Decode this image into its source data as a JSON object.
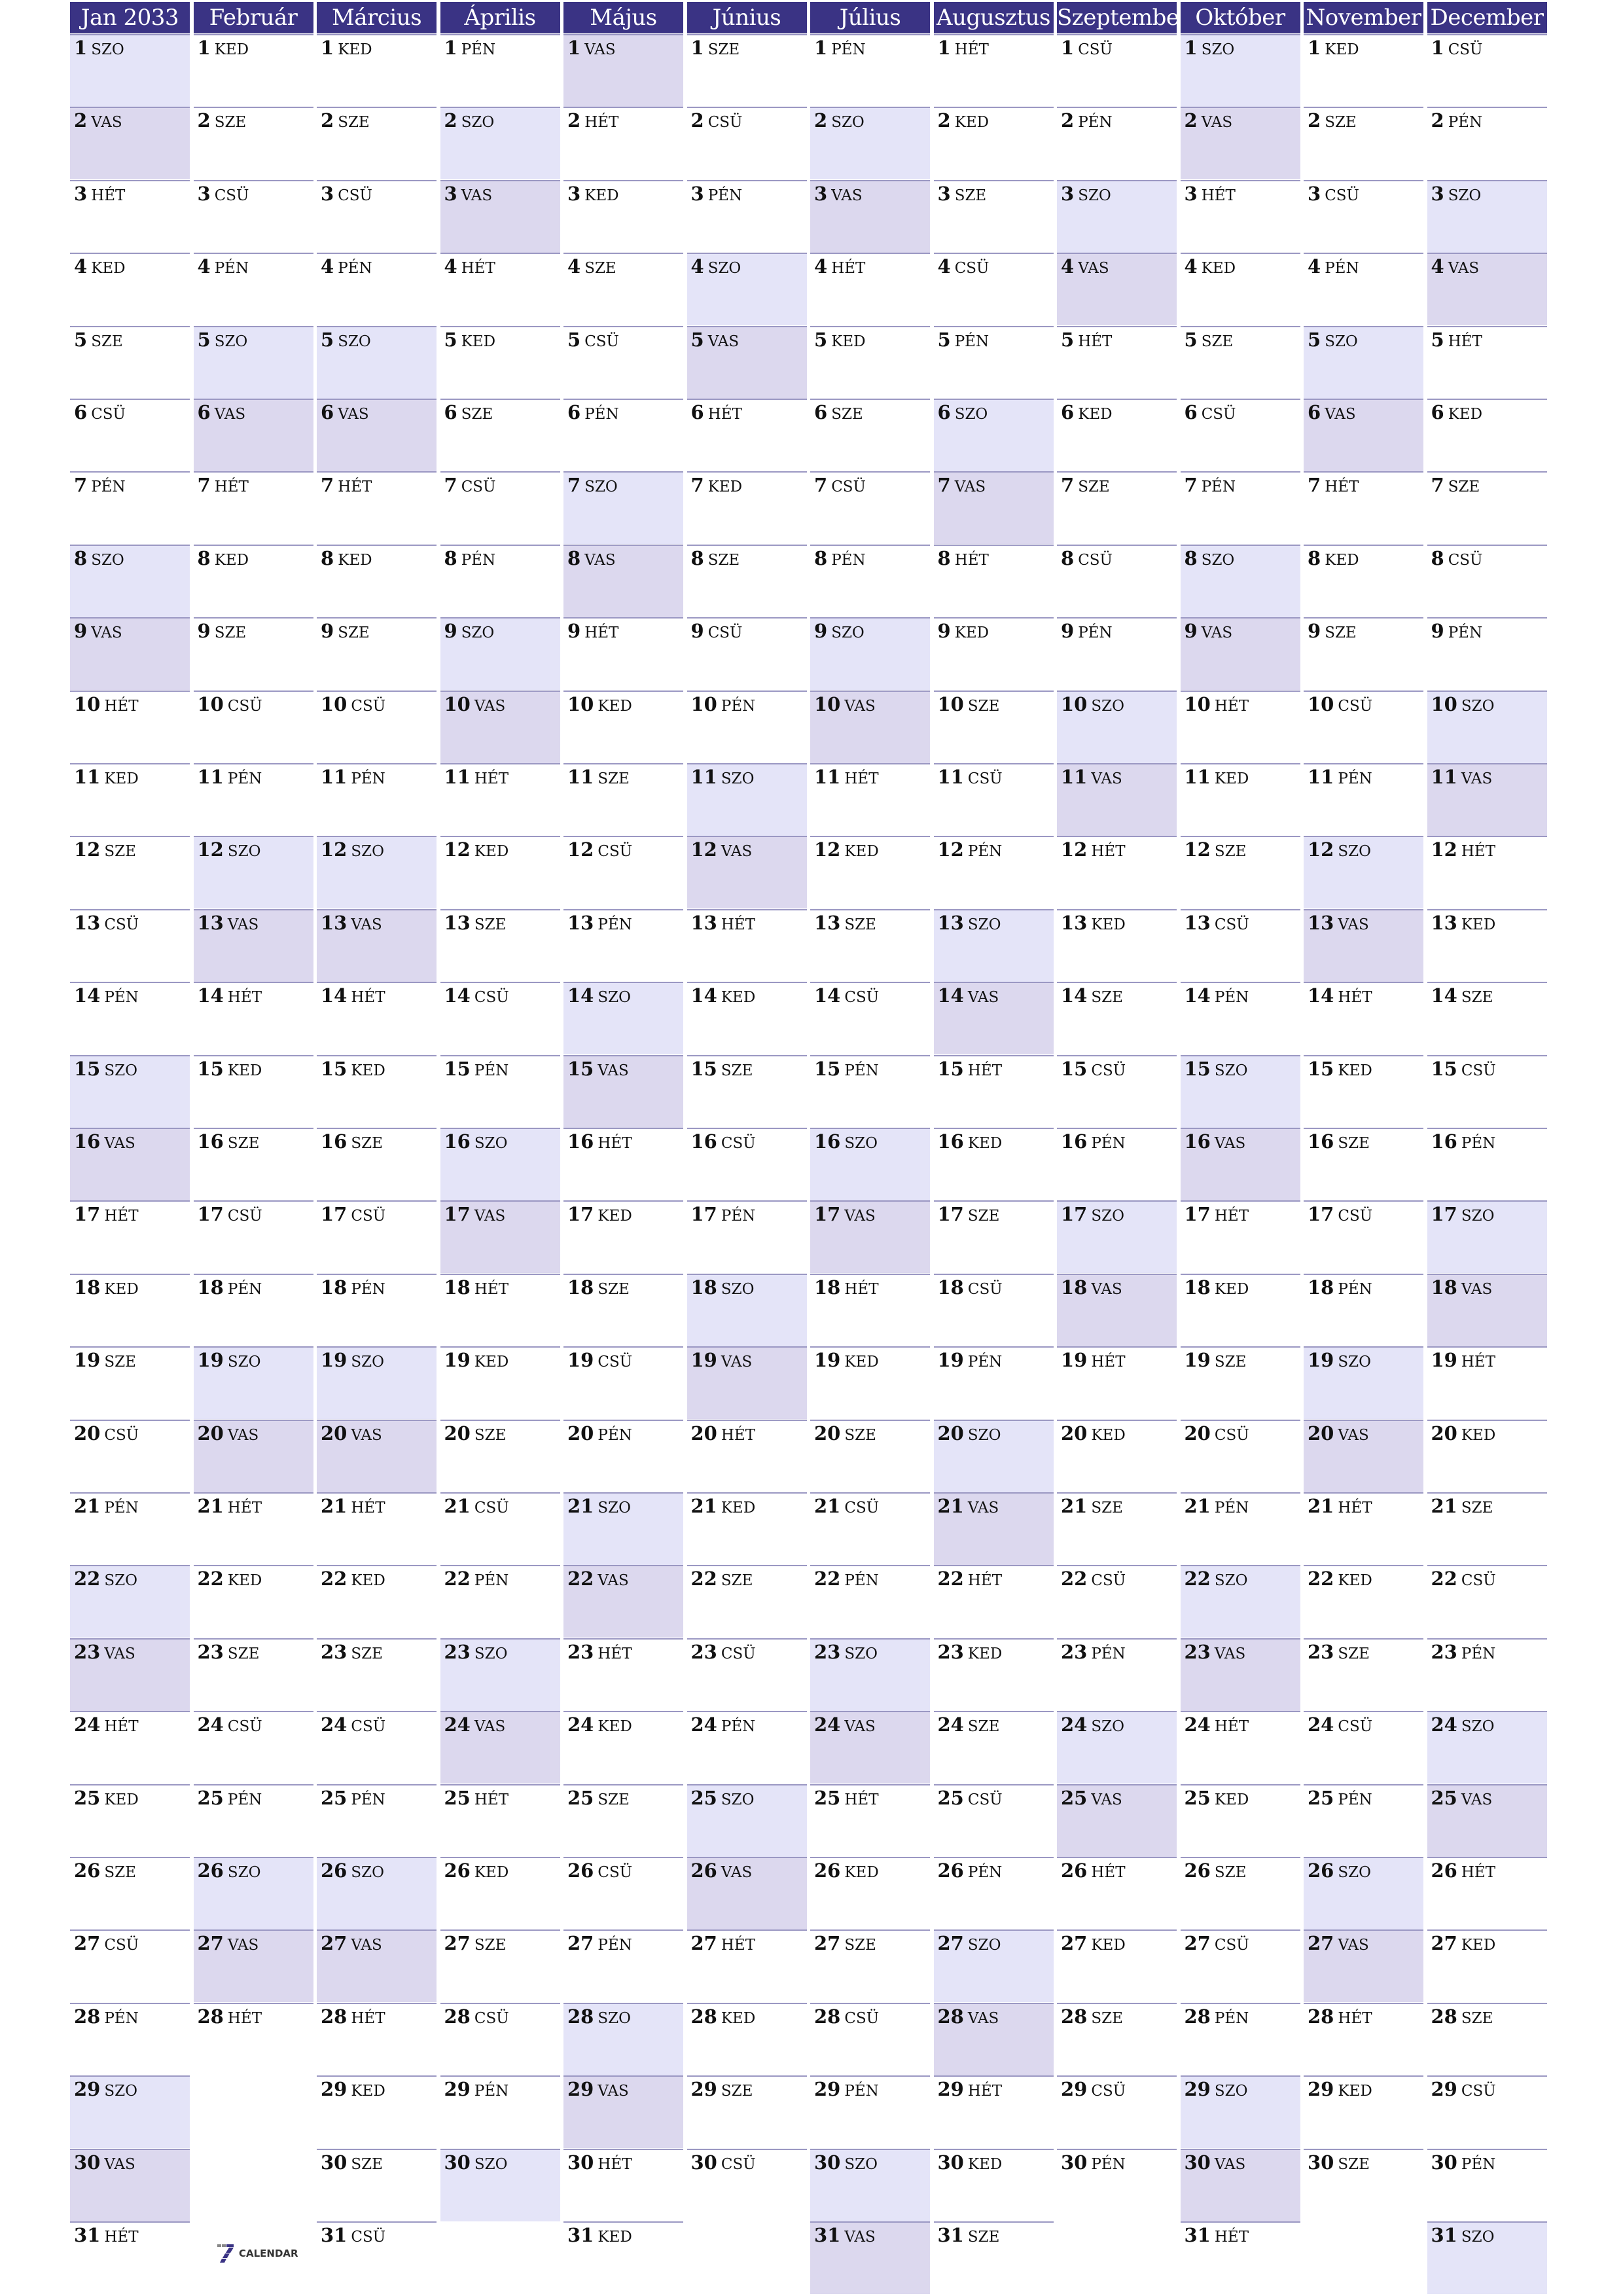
{
  "year": "2033",
  "months": [
    {
      "label": "Jan 2033",
      "days": [
        "SZO",
        "VAS",
        "HÉT",
        "KED",
        "SZE",
        "CSÜ",
        "PÉN",
        "SZO",
        "VAS",
        "HÉT",
        "KED",
        "SZE",
        "CSÜ",
        "PÉN",
        "SZO",
        "VAS",
        "HÉT",
        "KED",
        "SZE",
        "CSÜ",
        "PÉN",
        "SZO",
        "VAS",
        "HÉT",
        "KED",
        "SZE",
        "CSÜ",
        "PÉN",
        "SZO",
        "VAS",
        "HÉT"
      ]
    },
    {
      "label": "Február",
      "days": [
        "KED",
        "SZE",
        "CSÜ",
        "PÉN",
        "SZO",
        "VAS",
        "HÉT",
        "KED",
        "SZE",
        "CSÜ",
        "PÉN",
        "SZO",
        "VAS",
        "HÉT",
        "KED",
        "SZE",
        "CSÜ",
        "PÉN",
        "SZO",
        "VAS",
        "HÉT",
        "KED",
        "SZE",
        "CSÜ",
        "PÉN",
        "SZO",
        "VAS",
        "HÉT"
      ]
    },
    {
      "label": "Március",
      "days": [
        "KED",
        "SZE",
        "CSÜ",
        "PÉN",
        "SZO",
        "VAS",
        "HÉT",
        "KED",
        "SZE",
        "CSÜ",
        "PÉN",
        "SZO",
        "VAS",
        "HÉT",
        "KED",
        "SZE",
        "CSÜ",
        "PÉN",
        "SZO",
        "VAS",
        "HÉT",
        "KED",
        "SZE",
        "CSÜ",
        "PÉN",
        "SZO",
        "VAS",
        "HÉT",
        "KED",
        "SZE",
        "CSÜ"
      ]
    },
    {
      "label": "Április",
      "days": [
        "PÉN",
        "SZO",
        "VAS",
        "HÉT",
        "KED",
        "SZE",
        "CSÜ",
        "PÉN",
        "SZO",
        "VAS",
        "HÉT",
        "KED",
        "SZE",
        "CSÜ",
        "PÉN",
        "SZO",
        "VAS",
        "HÉT",
        "KED",
        "SZE",
        "CSÜ",
        "PÉN",
        "SZO",
        "VAS",
        "HÉT",
        "KED",
        "SZE",
        "CSÜ",
        "PÉN",
        "SZO"
      ]
    },
    {
      "label": "Május",
      "days": [
        "VAS",
        "HÉT",
        "KED",
        "SZE",
        "CSÜ",
        "PÉN",
        "SZO",
        "VAS",
        "HÉT",
        "KED",
        "SZE",
        "CSÜ",
        "PÉN",
        "SZO",
        "VAS",
        "HÉT",
        "KED",
        "SZE",
        "CSÜ",
        "PÉN",
        "SZO",
        "VAS",
        "HÉT",
        "KED",
        "SZE",
        "CSÜ",
        "PÉN",
        "SZO",
        "VAS",
        "HÉT",
        "KED"
      ]
    },
    {
      "label": "Június",
      "days": [
        "SZE",
        "CSÜ",
        "PÉN",
        "SZO",
        "VAS",
        "HÉT",
        "KED",
        "SZE",
        "CSÜ",
        "PÉN",
        "SZO",
        "VAS",
        "HÉT",
        "KED",
        "SZE",
        "CSÜ",
        "PÉN",
        "SZO",
        "VAS",
        "HÉT",
        "KED",
        "SZE",
        "CSÜ",
        "PÉN",
        "SZO",
        "VAS",
        "HÉT",
        "KED",
        "SZE",
        "CSÜ"
      ]
    },
    {
      "label": "Július",
      "days": [
        "PÉN",
        "SZO",
        "VAS",
        "HÉT",
        "KED",
        "SZE",
        "CSÜ",
        "PÉN",
        "SZO",
        "VAS",
        "HÉT",
        "KED",
        "SZE",
        "CSÜ",
        "PÉN",
        "SZO",
        "VAS",
        "HÉT",
        "KED",
        "SZE",
        "CSÜ",
        "PÉN",
        "SZO",
        "VAS",
        "HÉT",
        "KED",
        "SZE",
        "CSÜ",
        "PÉN",
        "SZO",
        "VAS"
      ]
    },
    {
      "label": "Augusztus",
      "days": [
        "HÉT",
        "KED",
        "SZE",
        "CSÜ",
        "PÉN",
        "SZO",
        "VAS",
        "HÉT",
        "KED",
        "SZE",
        "CSÜ",
        "PÉN",
        "SZO",
        "VAS",
        "HÉT",
        "KED",
        "SZE",
        "CSÜ",
        "PÉN",
        "SZO",
        "VAS",
        "HÉT",
        "KED",
        "SZE",
        "CSÜ",
        "PÉN",
        "SZO",
        "VAS",
        "HÉT",
        "KED",
        "SZE"
      ]
    },
    {
      "label": "Szeptember",
      "days": [
        "CSÜ",
        "PÉN",
        "SZO",
        "VAS",
        "HÉT",
        "KED",
        "SZE",
        "CSÜ",
        "PÉN",
        "SZO",
        "VAS",
        "HÉT",
        "KED",
        "SZE",
        "CSÜ",
        "PÉN",
        "SZO",
        "VAS",
        "HÉT",
        "KED",
        "SZE",
        "CSÜ",
        "PÉN",
        "SZO",
        "VAS",
        "HÉT",
        "KED",
        "SZE",
        "CSÜ",
        "PÉN"
      ]
    },
    {
      "label": "Október",
      "days": [
        "SZO",
        "VAS",
        "HÉT",
        "KED",
        "SZE",
        "CSÜ",
        "PÉN",
        "SZO",
        "VAS",
        "HÉT",
        "KED",
        "SZE",
        "CSÜ",
        "PÉN",
        "SZO",
        "VAS",
        "HÉT",
        "KED",
        "SZE",
        "CSÜ",
        "PÉN",
        "SZO",
        "VAS",
        "HÉT",
        "KED",
        "SZE",
        "CSÜ",
        "PÉN",
        "SZO",
        "VAS",
        "HÉT"
      ]
    },
    {
      "label": "November",
      "days": [
        "KED",
        "SZE",
        "CSÜ",
        "PÉN",
        "SZO",
        "VAS",
        "HÉT",
        "KED",
        "SZE",
        "CSÜ",
        "PÉN",
        "SZO",
        "VAS",
        "HÉT",
        "KED",
        "SZE",
        "CSÜ",
        "PÉN",
        "SZO",
        "VAS",
        "HÉT",
        "KED",
        "SZE",
        "CSÜ",
        "PÉN",
        "SZO",
        "VAS",
        "HÉT",
        "KED",
        "SZE"
      ]
    },
    {
      "label": "December",
      "days": [
        "CSÜ",
        "PÉN",
        "SZO",
        "VAS",
        "HÉT",
        "KED",
        "SZE",
        "CSÜ",
        "PÉN",
        "SZO",
        "VAS",
        "HÉT",
        "KED",
        "SZE",
        "CSÜ",
        "PÉN",
        "SZO",
        "VAS",
        "HÉT",
        "KED",
        "SZE",
        "CSÜ",
        "PÉN",
        "SZO",
        "VAS",
        "HÉT",
        "KED",
        "SZE",
        "CSÜ",
        "PÉN",
        "SZO"
      ]
    }
  ],
  "weekend": {
    "saturday": "SZO",
    "sunday": "VAS"
  },
  "colors": {
    "header": "#3a3384",
    "saturday": "#e4e4f8",
    "sunday": "#dcd8ee",
    "divider": "#9b98c3"
  },
  "logo": {
    "icon": "seven-calendar-logo-icon",
    "text": "CALENDAR"
  }
}
